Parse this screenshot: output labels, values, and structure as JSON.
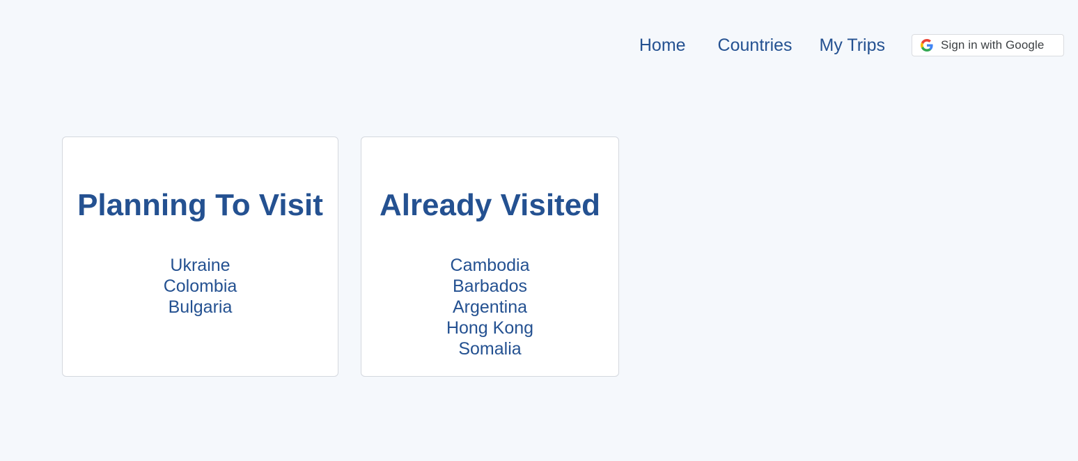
{
  "nav": {
    "home": "Home",
    "countries": "Countries",
    "my_trips": "My Trips",
    "google_signin": "Sign in with Google"
  },
  "colors": {
    "background": "#f5f8fc",
    "accent": "#245191",
    "card_border": "#d4d8de"
  },
  "icons": {
    "google_signin": "google-g-logo"
  },
  "planning": {
    "title": "Planning To Visit",
    "countries": [
      "Ukraine",
      "Colombia",
      "Bulgaria"
    ]
  },
  "visited": {
    "title": "Already Visited",
    "countries": [
      "Cambodia",
      "Barbados",
      "Argentina",
      "Hong Kong",
      "Somalia"
    ]
  }
}
